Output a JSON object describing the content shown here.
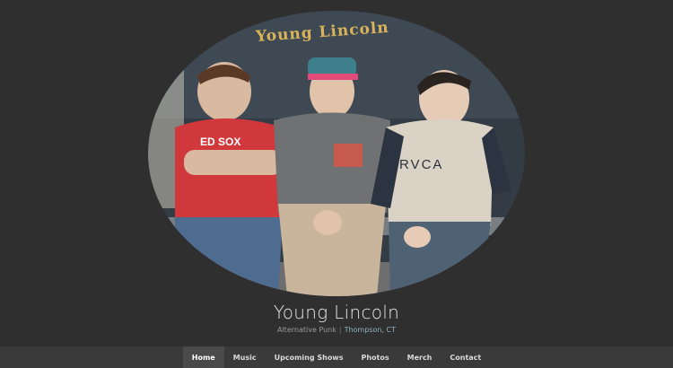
{
  "site": {
    "title": "Young Lincoln",
    "genre": "Alternative Punk",
    "separator": "|",
    "location": "Thompson, CT"
  },
  "photo": {
    "caption": "Young Lincoln",
    "shirt_text_left": "ED SOX",
    "shirt_text_right": "RVCA"
  },
  "nav": {
    "items": [
      {
        "label": "Home",
        "active": true
      },
      {
        "label": "Music"
      },
      {
        "label": "Upcoming Shows"
      },
      {
        "label": "Photos"
      },
      {
        "label": "Merch"
      },
      {
        "label": "Contact"
      }
    ]
  },
  "colors": {
    "background": "#2f2f2f",
    "nav_bar": "#3a3a3a",
    "nav_active": "#4a4a4a",
    "caption_gold": "#d8b35a",
    "location_blue": "#8fb3c9"
  }
}
